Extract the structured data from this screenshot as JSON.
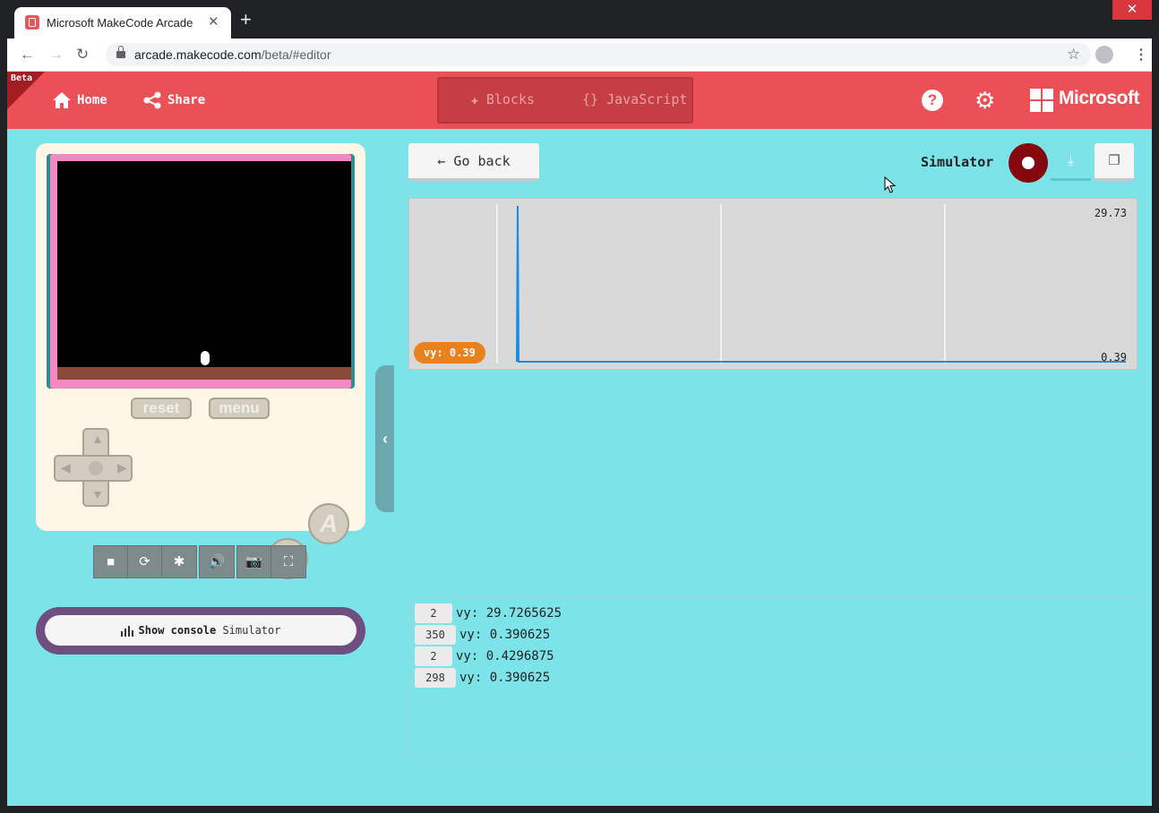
{
  "browser": {
    "tab_title": "Microsoft MakeCode Arcade",
    "tab_close": "✕",
    "new_tab": "+",
    "window_close": "✕",
    "back": "←",
    "forward": "→",
    "reload": "↻",
    "url_host": "arcade.makecode.com",
    "url_path": "/beta/#editor",
    "star": "☆",
    "menu": "⋮"
  },
  "header": {
    "beta_label": "Beta",
    "home_label": "Home",
    "share_label": "Share",
    "blocks_label": "Blocks",
    "javascript_label": "JavaScript",
    "help_label": "?",
    "gear": "⚙",
    "brand": "Microsoft"
  },
  "simulator": {
    "reset_label": "reset",
    "menu_label": "menu",
    "a_label": "A",
    "b_label": "B",
    "tools": [
      "■",
      "⟳",
      "✱",
      "🔊",
      "📷",
      "⛶"
    ],
    "console_button_bold": "Show console",
    "console_button_rest": "Simulator",
    "collapse": "‹"
  },
  "right": {
    "go_back_label": "Go back",
    "simulator_label": "Simulator",
    "download": "⤓",
    "copy": "❐"
  },
  "chart_data": {
    "type": "line",
    "series": [
      {
        "name": "vy",
        "values": [
          0.39,
          29.73,
          0.39,
          0.39,
          0.39,
          0.39,
          0.39,
          0.39
        ]
      }
    ],
    "current_label": "vy: 0.39",
    "max_label": "29.73",
    "min_label": "0.39",
    "ylim": [
      0.39,
      29.73
    ],
    "line_color": "#1e8be0",
    "tag_color": "#e8821e"
  },
  "console_log": [
    {
      "count": "2",
      "text": "vy: 29.7265625"
    },
    {
      "count": "350",
      "text": "vy: 0.390625"
    },
    {
      "count": "2",
      "text": "vy: 0.4296875"
    },
    {
      "count": "298",
      "text": "vy: 0.390625"
    }
  ]
}
